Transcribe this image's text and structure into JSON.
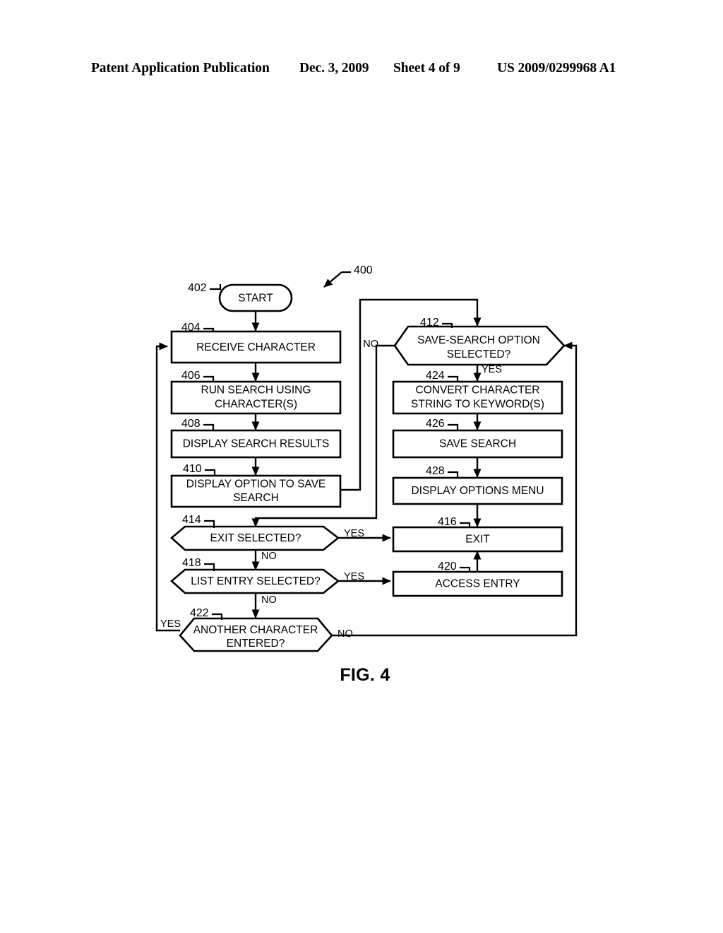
{
  "header": {
    "publication": "Patent Application Publication",
    "date": "Dec. 3, 2009",
    "sheet": "Sheet 4 of 9",
    "patent_number": "US 2009/0299968 A1"
  },
  "figure": {
    "caption": "FIG. 4",
    "diagram_reference": "400"
  },
  "nodes": {
    "n402": {
      "ref": "402",
      "label": "START",
      "type": "terminator"
    },
    "n404": {
      "ref": "404",
      "label": "RECEIVE CHARACTER",
      "type": "process"
    },
    "n406": {
      "ref": "406",
      "label_line1": "RUN SEARCH USING",
      "label_line2": "CHARACTER(S)",
      "type": "process"
    },
    "n408": {
      "ref": "408",
      "label": "DISPLAY SEARCH RESULTS",
      "type": "process"
    },
    "n410": {
      "ref": "410",
      "label_line1": "DISPLAY OPTION TO SAVE",
      "label_line2": "SEARCH",
      "type": "process"
    },
    "n412": {
      "ref": "412",
      "label_line1": "SAVE-SEARCH OPTION",
      "label_line2": "SELECTED?",
      "type": "decision"
    },
    "n414": {
      "ref": "414",
      "label": "EXIT SELECTED?",
      "type": "decision"
    },
    "n416": {
      "ref": "416",
      "label": "EXIT",
      "type": "process"
    },
    "n418": {
      "ref": "418",
      "label": "LIST ENTRY SELECTED?",
      "type": "decision"
    },
    "n420": {
      "ref": "420",
      "label": "ACCESS ENTRY",
      "type": "process"
    },
    "n422": {
      "ref": "422",
      "label_line1": "ANOTHER CHARACTER",
      "label_line2": "ENTERED?",
      "type": "decision"
    },
    "n424": {
      "ref": "424",
      "label_line1": "CONVERT CHARACTER",
      "label_line2": "STRING TO KEYWORD(S)",
      "type": "process"
    },
    "n426": {
      "ref": "426",
      "label": "SAVE SEARCH",
      "type": "process"
    },
    "n428": {
      "ref": "428",
      "label": "DISPLAY OPTIONS MENU",
      "type": "process"
    }
  },
  "edge_labels": {
    "e412_no": "NO",
    "e412_yes": "YES",
    "e414_yes": "YES",
    "e414_no": "NO",
    "e418_yes": "YES",
    "e418_no": "NO",
    "e422_yes": "YES",
    "e422_no": "NO"
  },
  "colors": {
    "ink": "#000000",
    "paper": "#ffffff"
  }
}
